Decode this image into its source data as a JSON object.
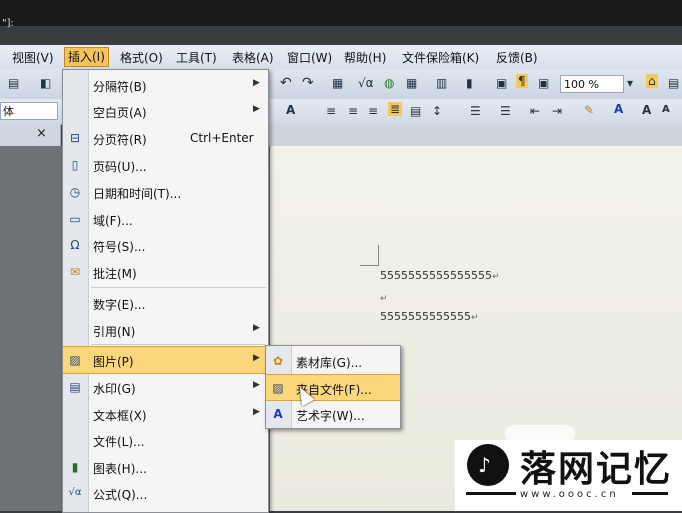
{
  "window": {
    "title_fragment": "\"]:"
  },
  "menubar": {
    "items": [
      "视图(V)",
      "插入(I)",
      "格式(O)",
      "工具(T)",
      "表格(A)",
      "窗口(W)",
      "帮助(H)",
      "文件保险箱(K)",
      "反馈(B)"
    ],
    "active": "插入(I)"
  },
  "toolbar": {
    "font_name": "体",
    "zoom": "100 %",
    "tab_close": "×"
  },
  "insert_menu": {
    "items": [
      {
        "icon": "break-icon",
        "label": "分隔符(B)",
        "has_submenu": true
      },
      {
        "icon": "blank-page-icon",
        "label": "空白页(A)",
        "has_submenu": true
      },
      {
        "icon": "page-break-icon",
        "label": "分页符(R)",
        "shortcut": "Ctrl+Enter"
      },
      {
        "icon": "page-number-icon",
        "label": "页码(U)..."
      },
      {
        "icon": "datetime-icon",
        "label": "日期和时间(T)..."
      },
      {
        "icon": "field-icon",
        "label": "域(F)..."
      },
      {
        "icon": "omega-icon",
        "label": "符号(S)..."
      },
      {
        "icon": "comment-icon",
        "label": "批注(M)"
      },
      {
        "icon": "",
        "label": "数字(E)..."
      },
      {
        "icon": "",
        "label": "引用(N)",
        "has_submenu": true
      },
      {
        "icon": "picture-icon",
        "label": "图片(P)",
        "has_submenu": true,
        "active": true
      },
      {
        "icon": "watermark-icon",
        "label": "水印(G)",
        "has_submenu": true
      },
      {
        "icon": "",
        "label": "文本框(X)",
        "has_submenu": true
      },
      {
        "icon": "",
        "label": "文件(L)..."
      },
      {
        "icon": "chart-icon",
        "label": "图表(H)..."
      },
      {
        "icon": "formula-icon",
        "label": "公式(Q)..."
      }
    ]
  },
  "picture_submenu": {
    "items": [
      {
        "icon": "clipart-icon",
        "label": "素材库(G)..."
      },
      {
        "icon": "from-file-icon",
        "label": "来自文件(F)...",
        "active": true
      },
      {
        "icon": "wordart-icon",
        "label": "艺术字(W)..."
      }
    ]
  },
  "document": {
    "lines": [
      "5555555555555555",
      "",
      "5555555555555"
    ],
    "para_mark": "↵"
  },
  "watermark": {
    "title": "落网记忆",
    "url": "www.oooc.cn"
  }
}
